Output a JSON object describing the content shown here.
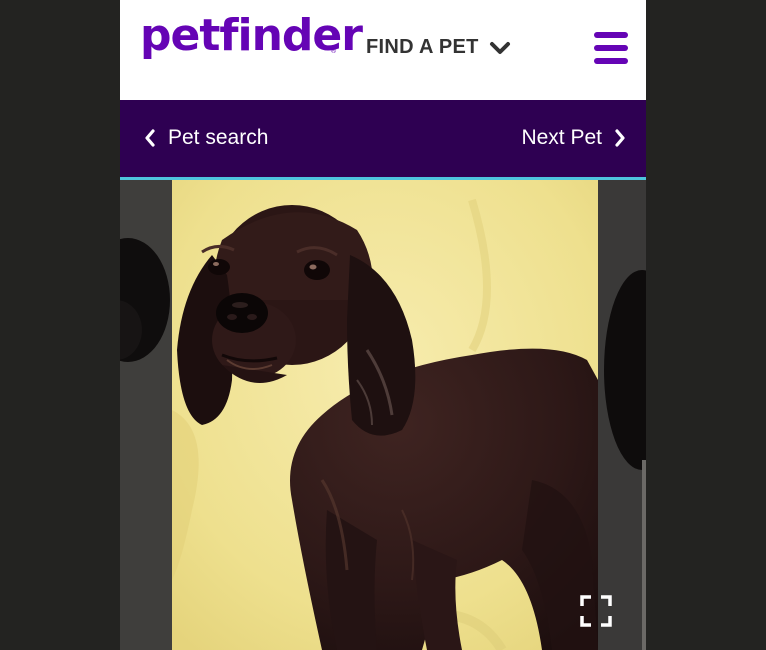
{
  "header": {
    "logo_text": "petfinder",
    "logo_mark": "®",
    "find_pet_label": "FIND A PET",
    "find_pet_icon": "chevron-down-icon",
    "menu_icon": "hamburger-menu-icon"
  },
  "navbar": {
    "back_label": "Pet search",
    "back_icon": "chevron-left-icon",
    "next_label": "Next Pet",
    "next_icon": "chevron-right-icon"
  },
  "gallery": {
    "expand_icon": "fullscreen-icon"
  },
  "colors": {
    "brand_purple": "#6504b5",
    "nav_purple": "#2e0052",
    "accent_cyan": "#4fc4de",
    "backdrop": "#232321"
  }
}
